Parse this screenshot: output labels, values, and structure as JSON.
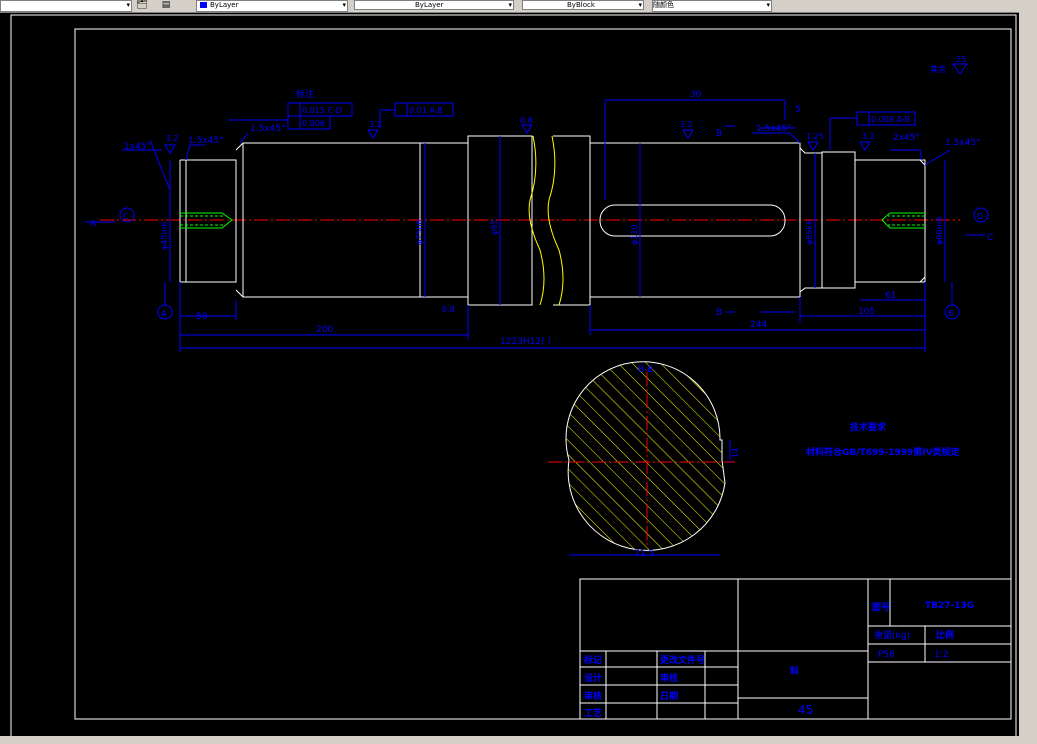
{
  "toolbar": {
    "linetype1": "ByLayer",
    "linetype2": "ByLayer",
    "lineweight": "ByBlock",
    "plotstyle": "随颜色"
  },
  "drawing": {
    "roughness_symbol": "其余",
    "roughness_value": "25",
    "gd_t_block_label": "标注",
    "gdt_frame_1a": "0.015 C-D",
    "gdt_frame_1b": "0.006",
    "gdt_frame_2": "0.01 A-B",
    "gdt_frame_3": "0.008 A-B",
    "cham_1": "1x45°",
    "cham_2": "1.5x45°",
    "cham_3": "1.5x45°",
    "cham_4": "1.5x45°",
    "cham_5": "2x45°",
    "cham_6": "1.5x45°",
    "rough_32a": "3.2",
    "rough_32b": "3.2",
    "rough_32c": "3.2",
    "rough_32d": "3.2",
    "rough_125": "1.25",
    "rough_08a": "0.8",
    "rough_08b": "0.8",
    "dim_30": "30",
    "dim_5": "5",
    "dim_50": "50",
    "dim_200": "200",
    "dim_244": "244",
    "dim_61": "61",
    "dim_105": "105",
    "dim_total": "1223H12(   )",
    "dia_45": "φ45m6",
    "dia_75": "φ75h6",
    "dia_95": "φ95",
    "dia_110": "φ110",
    "dia_65": "φ65k6",
    "dia_60": "φ60m6",
    "B1": "B",
    "B2": "B",
    "A_left": "A",
    "C_right": "C",
    "circ_A": "A",
    "circ_B": "B",
    "circ_C": "C",
    "circ_D": "D",
    "section_label": "B-B",
    "section_dim_14": "14",
    "section_dim_bottom": "71.5",
    "tech_title": "技术要求",
    "tech_body": "材料符合GB/T699-1999第IV类规定"
  },
  "title_block": {
    "drawing_no_label": "图号",
    "drawing_no": "TB27-13G",
    "mass_label": "重量(kg)",
    "scale_label": "比例",
    "mass_value": "P56",
    "scale_value": "1:2",
    "material_label": "料",
    "material_value": "45",
    "row1_left": "标记",
    "row1_right": "更改文件号",
    "row2_left": "设计",
    "row2_right": "审核",
    "row3_left": "审核",
    "row3_right": "日期",
    "row4_left": "工艺"
  },
  "colors": {
    "background": "#000000",
    "dimension": "#0000ff",
    "outline": "#ffffff",
    "centerline": "#ff0000",
    "hatch": "#ffff00",
    "thread": "#00ff00"
  }
}
